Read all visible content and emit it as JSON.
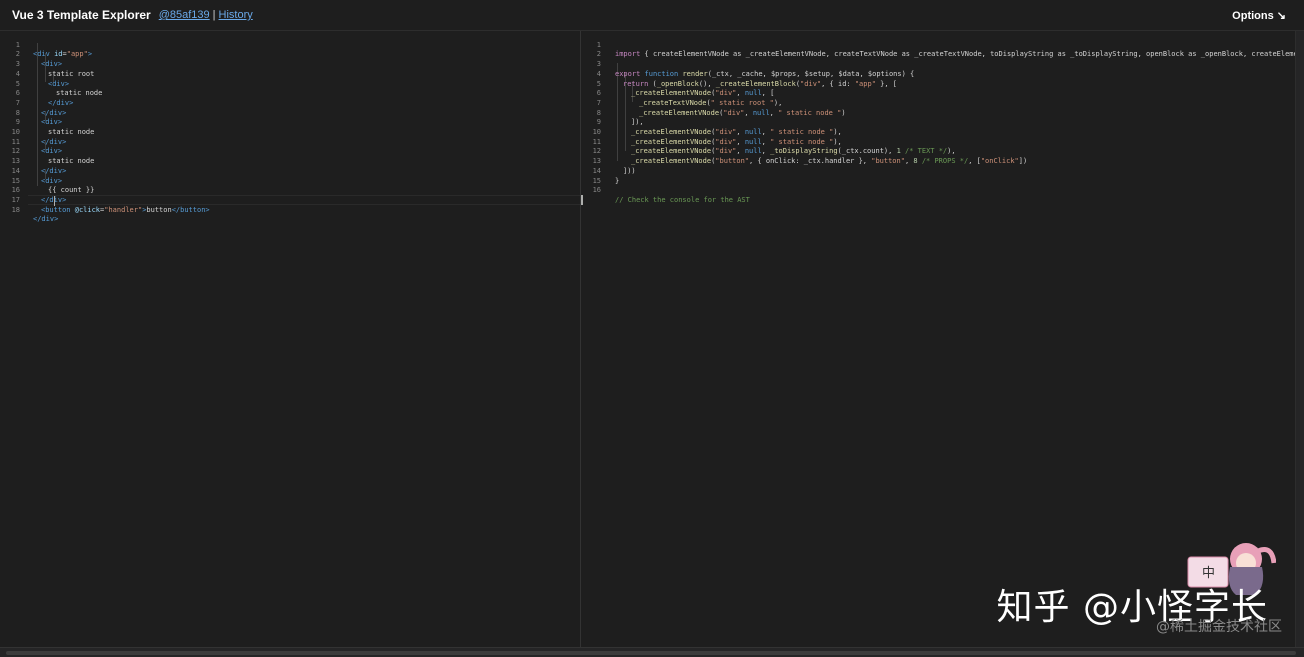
{
  "header": {
    "title": "Vue 3 Template Explorer",
    "commit": "@85af139",
    "separator": "|",
    "history": "History",
    "options": "Options ↘"
  },
  "template_lines": [
    {
      "n": "1",
      "indent": 0
    },
    {
      "n": "2",
      "indent": 1
    },
    {
      "n": "3",
      "indent": 2
    },
    {
      "n": "4",
      "indent": 2
    },
    {
      "n": "5",
      "indent": 3
    },
    {
      "n": "6",
      "indent": 2
    },
    {
      "n": "7",
      "indent": 1
    },
    {
      "n": "8",
      "indent": 1
    },
    {
      "n": "9",
      "indent": 2
    },
    {
      "n": "10",
      "indent": 1
    },
    {
      "n": "11",
      "indent": 1
    },
    {
      "n": "12",
      "indent": 2
    },
    {
      "n": "13",
      "indent": 1
    },
    {
      "n": "14",
      "indent": 1
    },
    {
      "n": "15",
      "indent": 2
    },
    {
      "n": "16",
      "indent": 1
    },
    {
      "n": "17",
      "indent": 1
    },
    {
      "n": "18",
      "indent": 0
    }
  ],
  "template_text": {
    "l1_open": "<div",
    "l1_attr": "id",
    "l1_eq": "=",
    "l1_val": "\"app\"",
    "l1_close": ">",
    "div_open": "<div>",
    "div_close": "</div>",
    "static_root": "static root",
    "static_node": "static node",
    "count": "{{ count }}",
    "btn_open": "<button",
    "btn_attr": "@click",
    "btn_eq": "=",
    "btn_val": "\"handler\"",
    "btn_gt": ">",
    "btn_text": "button",
    "btn_close": "</button>",
    "last_close": "</div>"
  },
  "output_line_numbers": [
    "1",
    "2",
    "3",
    "4",
    "5",
    "6",
    "7",
    "8",
    "9",
    "10",
    "11",
    "12",
    "13",
    "14",
    "15",
    "16"
  ],
  "output_text": {
    "l1_import": "import",
    "l1_rest": " { createElementVNode as _createElementVNode, createTextVNode as _createTextVNode, toDisplayString as _toDisplayString, openBlock as _openBlock, createElementBlock as _c",
    "l3_export": "export",
    "l3_function": " function ",
    "l3_render": "render",
    "l3_args": "(_ctx, _cache, $props, $setup, $data, $options) {",
    "l4_return": "return",
    "l4_open": " (",
    "l4_openBlock": "_openBlock",
    "l4_mid": "(), ",
    "l4_ceb": "_createElementBlock",
    "l4_p1": "(",
    "l4_div": "\"div\"",
    "l4_p2": ", { id: ",
    "l4_app": "\"app\"",
    "l4_p3": " }, [",
    "cev": "_createElementVNode",
    "ctv": "_createTextVNode",
    "p_open": "(",
    "div_str": "\"div\"",
    "null_kw": "null",
    "comma": ", ",
    "l5_tail": ", [",
    "l6_str": "\" static root \"",
    "l6_tail": "),",
    "l7_str": "\" static node \"",
    "l7_tail": ")",
    "l8": "]),",
    "l9_str": "\" static node \"",
    "l9_tail": "),",
    "l10_str": "\" static node \"",
    "l10_tail": "),",
    "l11_tds": "_toDisplayString",
    "l11_arg": "(_ctx.count), ",
    "l11_num": "1",
    "l11_cmt": " /* TEXT */",
    "l11_tail": "),",
    "l12_btn": "\"button\"",
    "l12_mid": ", { onClick: _ctx.handler }, ",
    "l12_btn2": "\"button\"",
    "l12_comma": ", ",
    "l12_num": "8",
    "l12_cmt": " /* PROPS */",
    "l12_arr": ", [",
    "l12_onclick": "\"onClick\"",
    "l12_tail": "])",
    "l13": "]))",
    "l14": "}",
    "l16_cmt": "// Check the console for the AST"
  },
  "watermark": {
    "main": "知乎 @小怪字长",
    "sub": "@稀土掘金技术社区",
    "badge": "中"
  },
  "colors": {
    "background": "#1e1e1e",
    "tag": "#569cd6",
    "attr": "#9cdcfe",
    "string": "#ce9178",
    "keyword": "#c586c0",
    "function": "#dcdcaa",
    "number": "#b5cea8",
    "comment": "#6a9955",
    "link": "#6aa9e9"
  }
}
